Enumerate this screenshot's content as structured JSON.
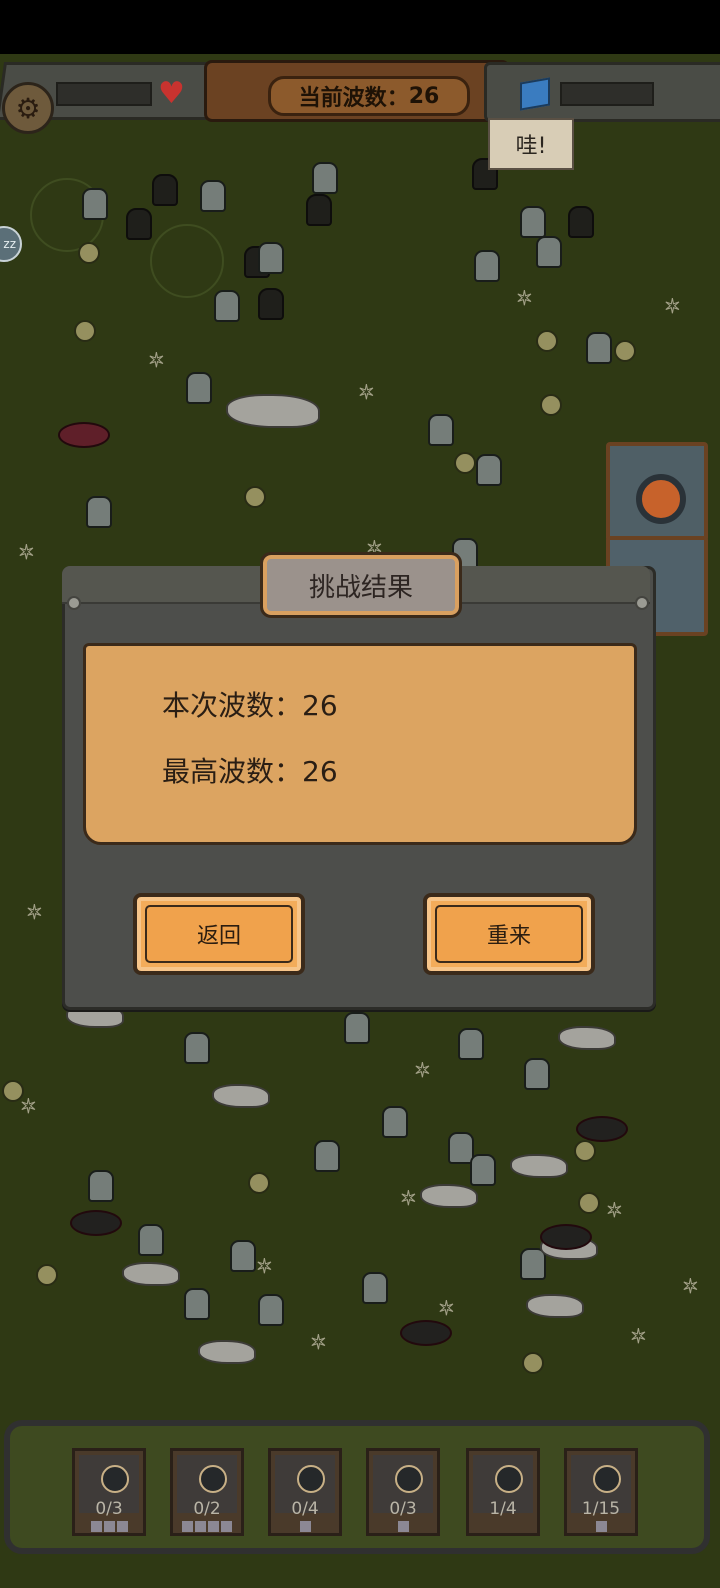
{
  "hud": {
    "wave_label": "当前波数",
    "wave_colon": "：",
    "wave_value": "26",
    "speech_bubble": "哇!",
    "sleep_badge": "zz"
  },
  "dialog": {
    "title": "挑战结果",
    "rows": [
      {
        "label": "本次波数",
        "colon": "：",
        "value": "26"
      },
      {
        "label": "最高波数",
        "colon": "：",
        "value": "26"
      }
    ],
    "back_button": "返回",
    "retry_button": "重来"
  },
  "units": [
    {
      "count": "0/3",
      "dots": 3
    },
    {
      "count": "0/2",
      "dots": 4
    },
    {
      "count": "0/4",
      "dots": 1
    },
    {
      "count": "0/3",
      "dots": 1
    },
    {
      "count": "1/4",
      "dots": 0
    },
    {
      "count": "1/15",
      "dots": 1
    }
  ],
  "colors": {
    "field": "#3a4619",
    "panel": "#dca461",
    "button": "#f3ac5a",
    "heart": "#c8332f",
    "gem": "#3a7cc0"
  }
}
